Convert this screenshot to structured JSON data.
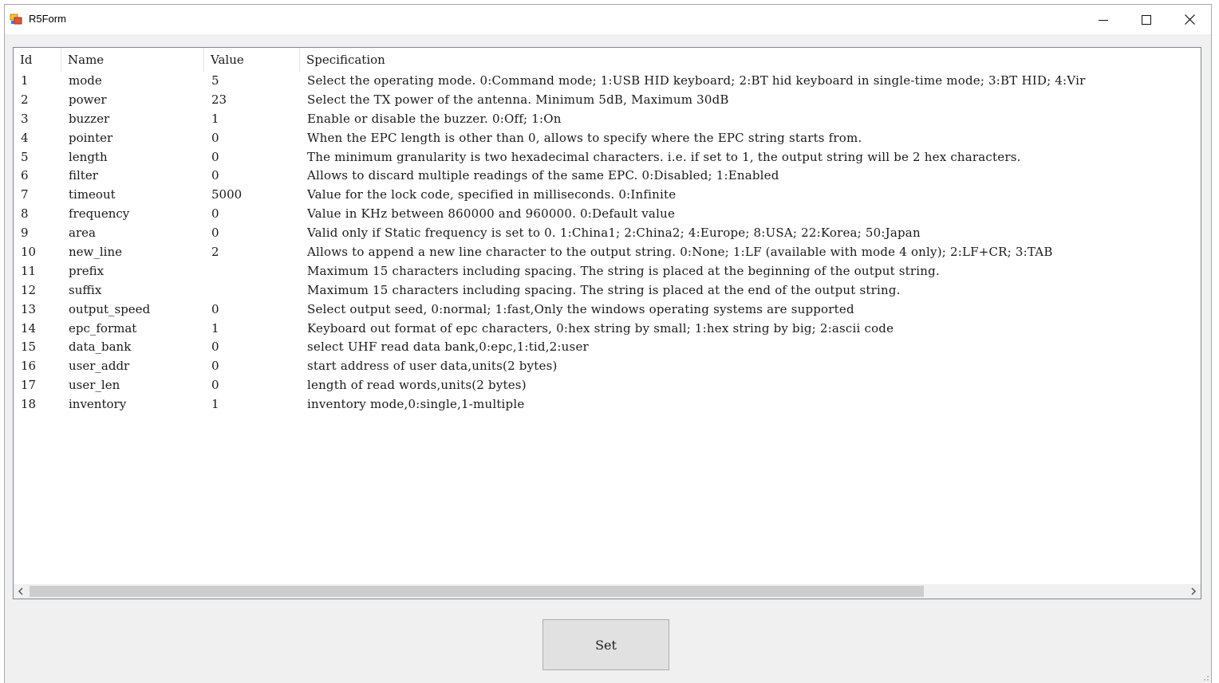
{
  "window": {
    "title": "R5Form"
  },
  "table": {
    "columns": [
      "Id",
      "Name",
      "Value",
      "Specification"
    ],
    "rows": [
      {
        "id": "1",
        "name": "mode",
        "value": "5",
        "spec": "Select the operating mode. 0:Command mode; 1:USB HID keyboard; 2:BT hid keyboard in single-time mode; 3:BT HID; 4:Vir"
      },
      {
        "id": "2",
        "name": "power",
        "value": "23",
        "spec": "Select the TX power of the antenna. Minimum 5dB, Maximum 30dB"
      },
      {
        "id": "3",
        "name": "buzzer",
        "value": "1",
        "spec": "Enable or disable the buzzer. 0:Off; 1:On"
      },
      {
        "id": "4",
        "name": "pointer",
        "value": "0",
        "spec": "When the EPC length is other than 0, allows to specify where the EPC string starts from."
      },
      {
        "id": "5",
        "name": "length",
        "value": "0",
        "spec": "The minimum granularity is two hexadecimal characters. i.e. if set to 1, the output string will be 2 hex characters."
      },
      {
        "id": "6",
        "name": "filter",
        "value": "0",
        "spec": "Allows to discard multiple readings of the same EPC. 0:Disabled; 1:Enabled"
      },
      {
        "id": "7",
        "name": "timeout",
        "value": "5000",
        "spec": "Value for the lock code, specified in milliseconds. 0:Infinite"
      },
      {
        "id": "8",
        "name": "frequency",
        "value": "0",
        "spec": "Value in KHz between 860000 and 960000. 0:Default value"
      },
      {
        "id": "9",
        "name": "area",
        "value": "0",
        "spec": "Valid only if Static frequency is set to 0. 1:China1; 2:China2; 4:Europe; 8:USA; 22:Korea; 50:Japan"
      },
      {
        "id": "10",
        "name": "new_line",
        "value": "2",
        "spec": "Allows to append a new line character to the output string. 0:None; 1:LF (available with mode 4 only); 2:LF+CR; 3:TAB"
      },
      {
        "id": "11",
        "name": "prefix",
        "value": "",
        "spec": "Maximum 15 characters including spacing. The string is placed at the beginning of the output string."
      },
      {
        "id": "12",
        "name": "suffix",
        "value": "",
        "spec": "Maximum 15 characters including spacing. The string is placed at the end of the output string."
      },
      {
        "id": "13",
        "name": "output_speed",
        "value": "0",
        "spec": "Select output seed, 0:normal; 1:fast,Only the windows operating systems are supported"
      },
      {
        "id": "14",
        "name": "epc_format",
        "value": "1",
        "spec": "Keyboard out format of epc characters, 0:hex string by small; 1:hex string by big; 2:ascii code"
      },
      {
        "id": "15",
        "name": "data_bank",
        "value": "0",
        "spec": "select UHF read data bank,0:epc,1:tid,2:user"
      },
      {
        "id": "16",
        "name": "user_addr",
        "value": "0",
        "spec": "start address of user data,units(2 bytes)"
      },
      {
        "id": "17",
        "name": "user_len",
        "value": "0",
        "spec": "length of read words,units(2 bytes)"
      },
      {
        "id": "18",
        "name": "inventory",
        "value": "1",
        "spec": "inventory mode,0:single,1-multiple"
      }
    ]
  },
  "buttons": {
    "set_label": "Set"
  }
}
